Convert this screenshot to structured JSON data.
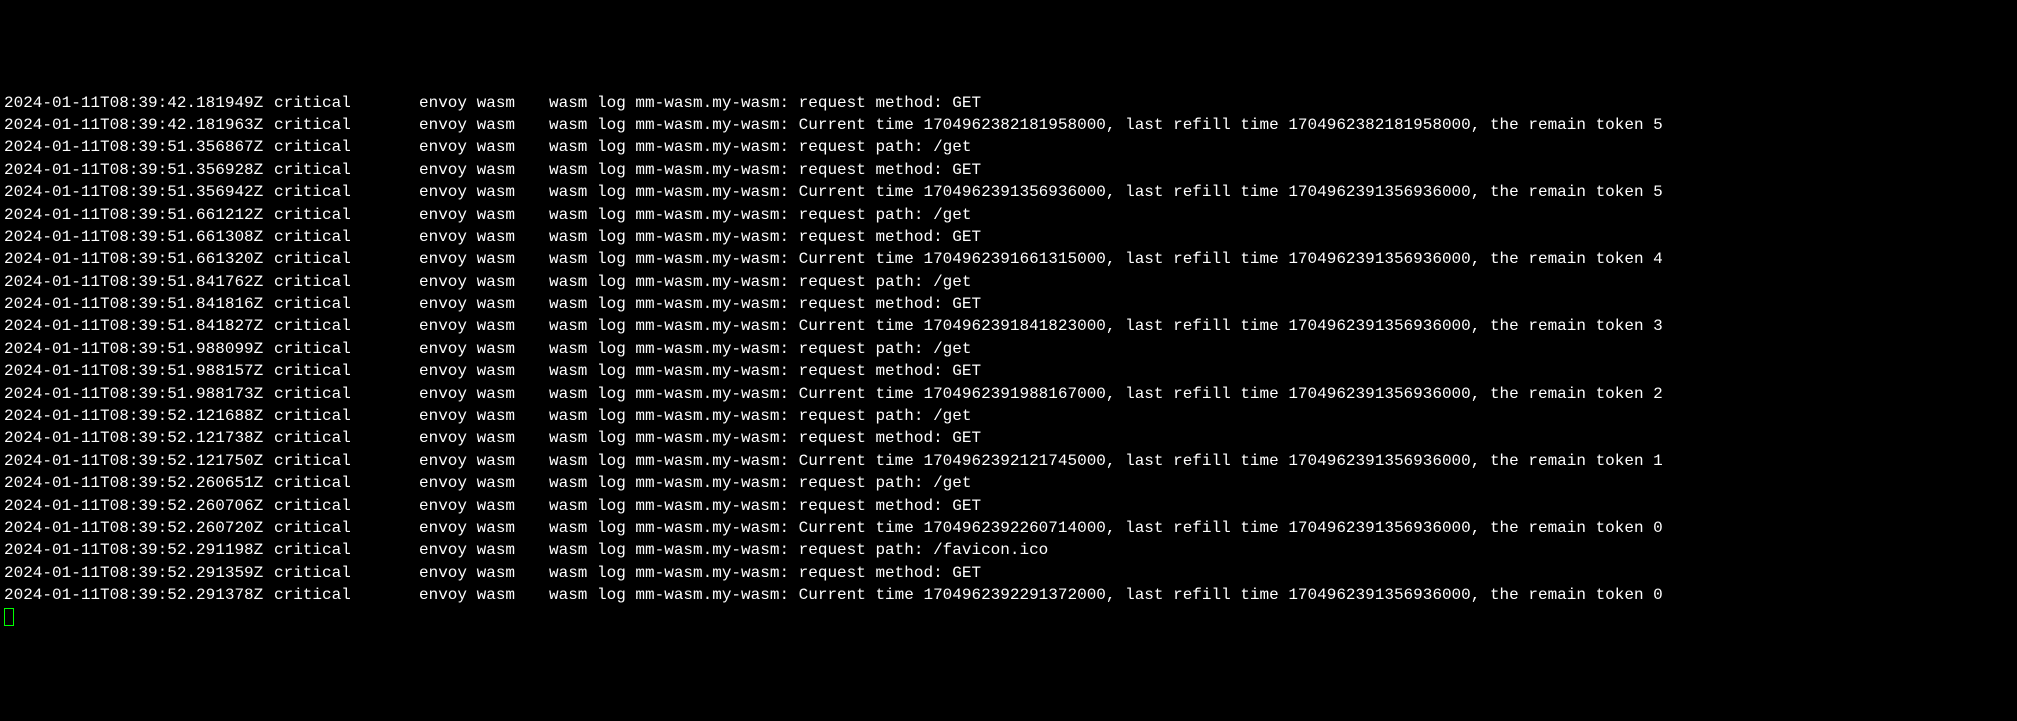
{
  "log_lines": [
    {
      "ts": "2024-01-11T08:39:42.181949Z",
      "lvl": "critical",
      "src": "envoy wasm",
      "msg": "wasm log mm-wasm.my-wasm: request method: GET"
    },
    {
      "ts": "2024-01-11T08:39:42.181963Z",
      "lvl": "critical",
      "src": "envoy wasm",
      "msg": "wasm log mm-wasm.my-wasm: Current time 1704962382181958000, last refill time 1704962382181958000, the remain token 5"
    },
    {
      "ts": "2024-01-11T08:39:51.356867Z",
      "lvl": "critical",
      "src": "envoy wasm",
      "msg": "wasm log mm-wasm.my-wasm: request path: /get"
    },
    {
      "ts": "2024-01-11T08:39:51.356928Z",
      "lvl": "critical",
      "src": "envoy wasm",
      "msg": "wasm log mm-wasm.my-wasm: request method: GET"
    },
    {
      "ts": "2024-01-11T08:39:51.356942Z",
      "lvl": "critical",
      "src": "envoy wasm",
      "msg": "wasm log mm-wasm.my-wasm: Current time 1704962391356936000, last refill time 1704962391356936000, the remain token 5"
    },
    {
      "ts": "2024-01-11T08:39:51.661212Z",
      "lvl": "critical",
      "src": "envoy wasm",
      "msg": "wasm log mm-wasm.my-wasm: request path: /get"
    },
    {
      "ts": "2024-01-11T08:39:51.661308Z",
      "lvl": "critical",
      "src": "envoy wasm",
      "msg": "wasm log mm-wasm.my-wasm: request method: GET"
    },
    {
      "ts": "2024-01-11T08:39:51.661320Z",
      "lvl": "critical",
      "src": "envoy wasm",
      "msg": "wasm log mm-wasm.my-wasm: Current time 1704962391661315000, last refill time 1704962391356936000, the remain token 4"
    },
    {
      "ts": "2024-01-11T08:39:51.841762Z",
      "lvl": "critical",
      "src": "envoy wasm",
      "msg": "wasm log mm-wasm.my-wasm: request path: /get"
    },
    {
      "ts": "2024-01-11T08:39:51.841816Z",
      "lvl": "critical",
      "src": "envoy wasm",
      "msg": "wasm log mm-wasm.my-wasm: request method: GET"
    },
    {
      "ts": "2024-01-11T08:39:51.841827Z",
      "lvl": "critical",
      "src": "envoy wasm",
      "msg": "wasm log mm-wasm.my-wasm: Current time 1704962391841823000, last refill time 1704962391356936000, the remain token 3"
    },
    {
      "ts": "2024-01-11T08:39:51.988099Z",
      "lvl": "critical",
      "src": "envoy wasm",
      "msg": "wasm log mm-wasm.my-wasm: request path: /get"
    },
    {
      "ts": "2024-01-11T08:39:51.988157Z",
      "lvl": "critical",
      "src": "envoy wasm",
      "msg": "wasm log mm-wasm.my-wasm: request method: GET"
    },
    {
      "ts": "2024-01-11T08:39:51.988173Z",
      "lvl": "critical",
      "src": "envoy wasm",
      "msg": "wasm log mm-wasm.my-wasm: Current time 1704962391988167000, last refill time 1704962391356936000, the remain token 2"
    },
    {
      "ts": "2024-01-11T08:39:52.121688Z",
      "lvl": "critical",
      "src": "envoy wasm",
      "msg": "wasm log mm-wasm.my-wasm: request path: /get"
    },
    {
      "ts": "2024-01-11T08:39:52.121738Z",
      "lvl": "critical",
      "src": "envoy wasm",
      "msg": "wasm log mm-wasm.my-wasm: request method: GET"
    },
    {
      "ts": "2024-01-11T08:39:52.121750Z",
      "lvl": "critical",
      "src": "envoy wasm",
      "msg": "wasm log mm-wasm.my-wasm: Current time 1704962392121745000, last refill time 1704962391356936000, the remain token 1"
    },
    {
      "ts": "2024-01-11T08:39:52.260651Z",
      "lvl": "critical",
      "src": "envoy wasm",
      "msg": "wasm log mm-wasm.my-wasm: request path: /get"
    },
    {
      "ts": "2024-01-11T08:39:52.260706Z",
      "lvl": "critical",
      "src": "envoy wasm",
      "msg": "wasm log mm-wasm.my-wasm: request method: GET"
    },
    {
      "ts": "2024-01-11T08:39:52.260720Z",
      "lvl": "critical",
      "src": "envoy wasm",
      "msg": "wasm log mm-wasm.my-wasm: Current time 1704962392260714000, last refill time 1704962391356936000, the remain token 0"
    },
    {
      "ts": "2024-01-11T08:39:52.291198Z",
      "lvl": "critical",
      "src": "envoy wasm",
      "msg": "wasm log mm-wasm.my-wasm: request path: /favicon.ico"
    },
    {
      "ts": "2024-01-11T08:39:52.291359Z",
      "lvl": "critical",
      "src": "envoy wasm",
      "msg": "wasm log mm-wasm.my-wasm: request method: GET"
    },
    {
      "ts": "2024-01-11T08:39:52.291378Z",
      "lvl": "critical",
      "src": "envoy wasm",
      "msg": "wasm log mm-wasm.my-wasm: Current time 1704962392291372000, last refill time 1704962391356936000, the remain token 0"
    }
  ]
}
